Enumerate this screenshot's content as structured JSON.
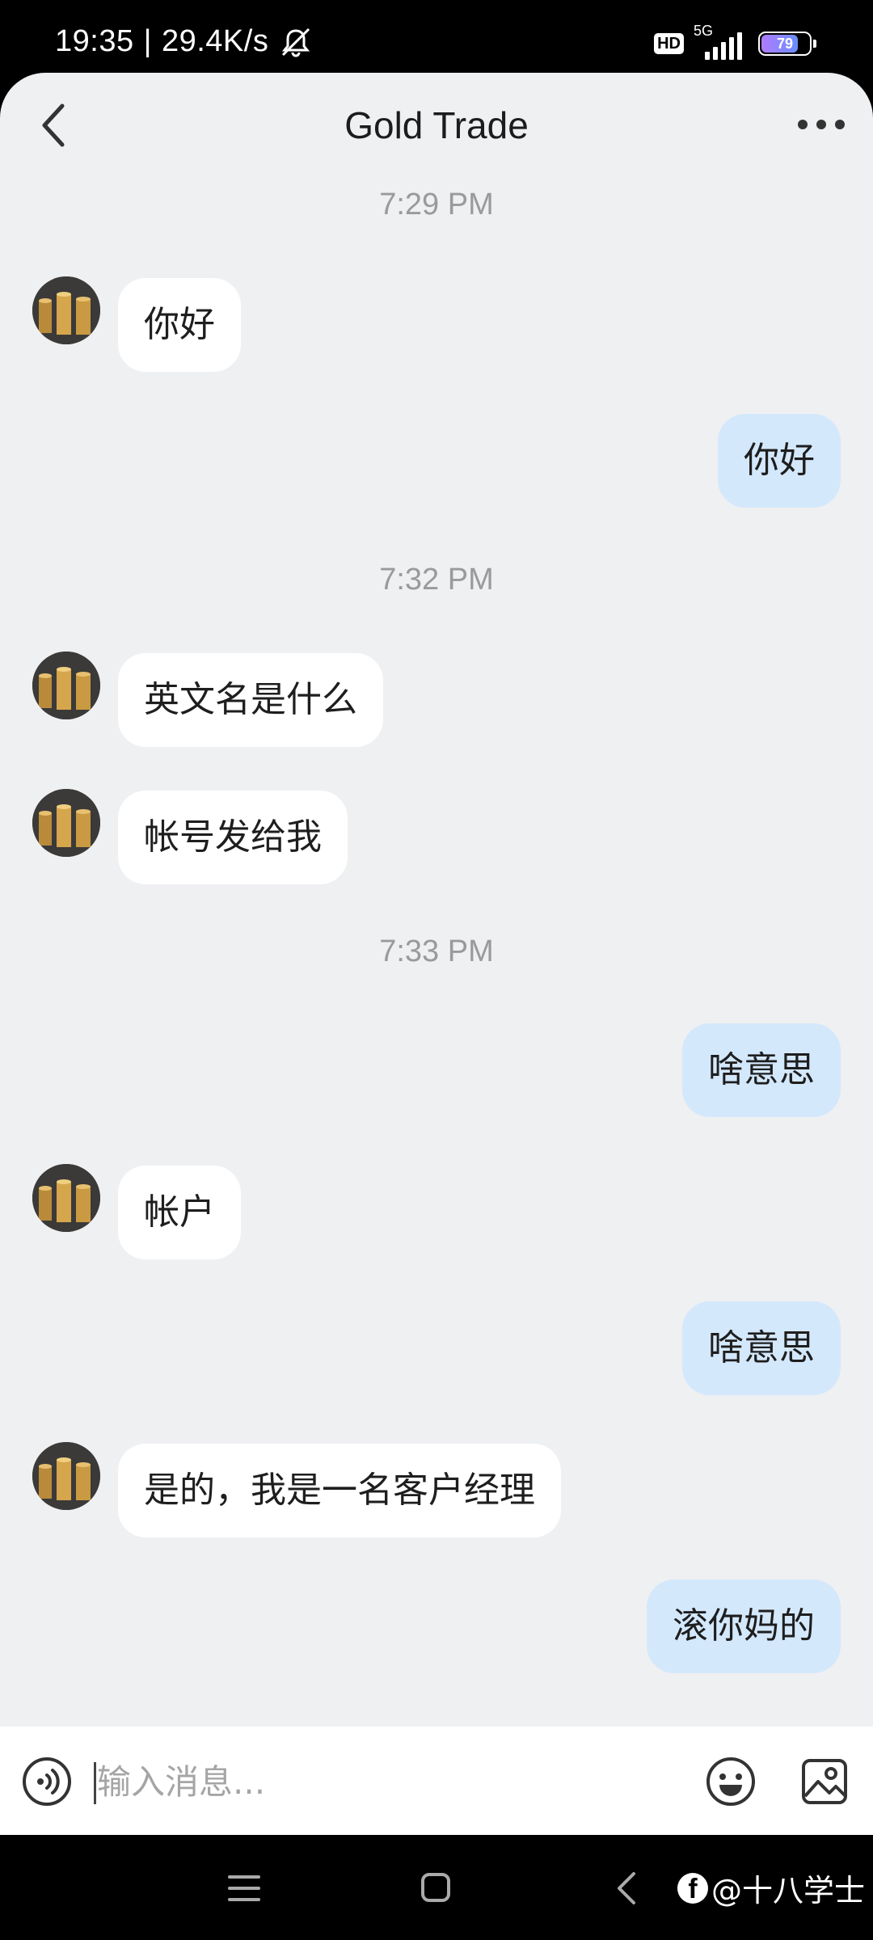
{
  "status_bar": {
    "time": "19:35",
    "network_speed": "29.4K/s",
    "hd_label": "HD",
    "network_type": "5G",
    "battery_level": "79"
  },
  "header": {
    "title": "Gold Trade",
    "back_icon": "chevron-left-icon",
    "more_icon": "more-dots-icon"
  },
  "chat": {
    "timestamps": [
      "7:29 PM",
      "7:32 PM",
      "7:33 PM"
    ],
    "messages": [
      {
        "side": "in",
        "text": "你好"
      },
      {
        "side": "out",
        "text": "你好"
      },
      {
        "side": "in",
        "text": "英文名是什么"
      },
      {
        "side": "in",
        "text": "帐号发给我"
      },
      {
        "side": "out",
        "text": "啥意思"
      },
      {
        "side": "in",
        "text": "帐户"
      },
      {
        "side": "out",
        "text": "啥意思"
      },
      {
        "side": "in",
        "text": "是的，我是一名客户经理"
      },
      {
        "side": "out",
        "text": "滚你妈的"
      }
    ]
  },
  "input_bar": {
    "placeholder": "输入消息...",
    "value": "",
    "icons": [
      "voice-icon",
      "emoji-icon",
      "image-icon"
    ]
  },
  "nav_bar": {
    "watermark": "@十八学士",
    "icons": [
      "menu-icon",
      "home-icon",
      "back-icon"
    ]
  },
  "colors": {
    "background": "#eff0f2",
    "incoming_bubble": "#ffffff",
    "outgoing_bubble": "#d4e8fc"
  }
}
